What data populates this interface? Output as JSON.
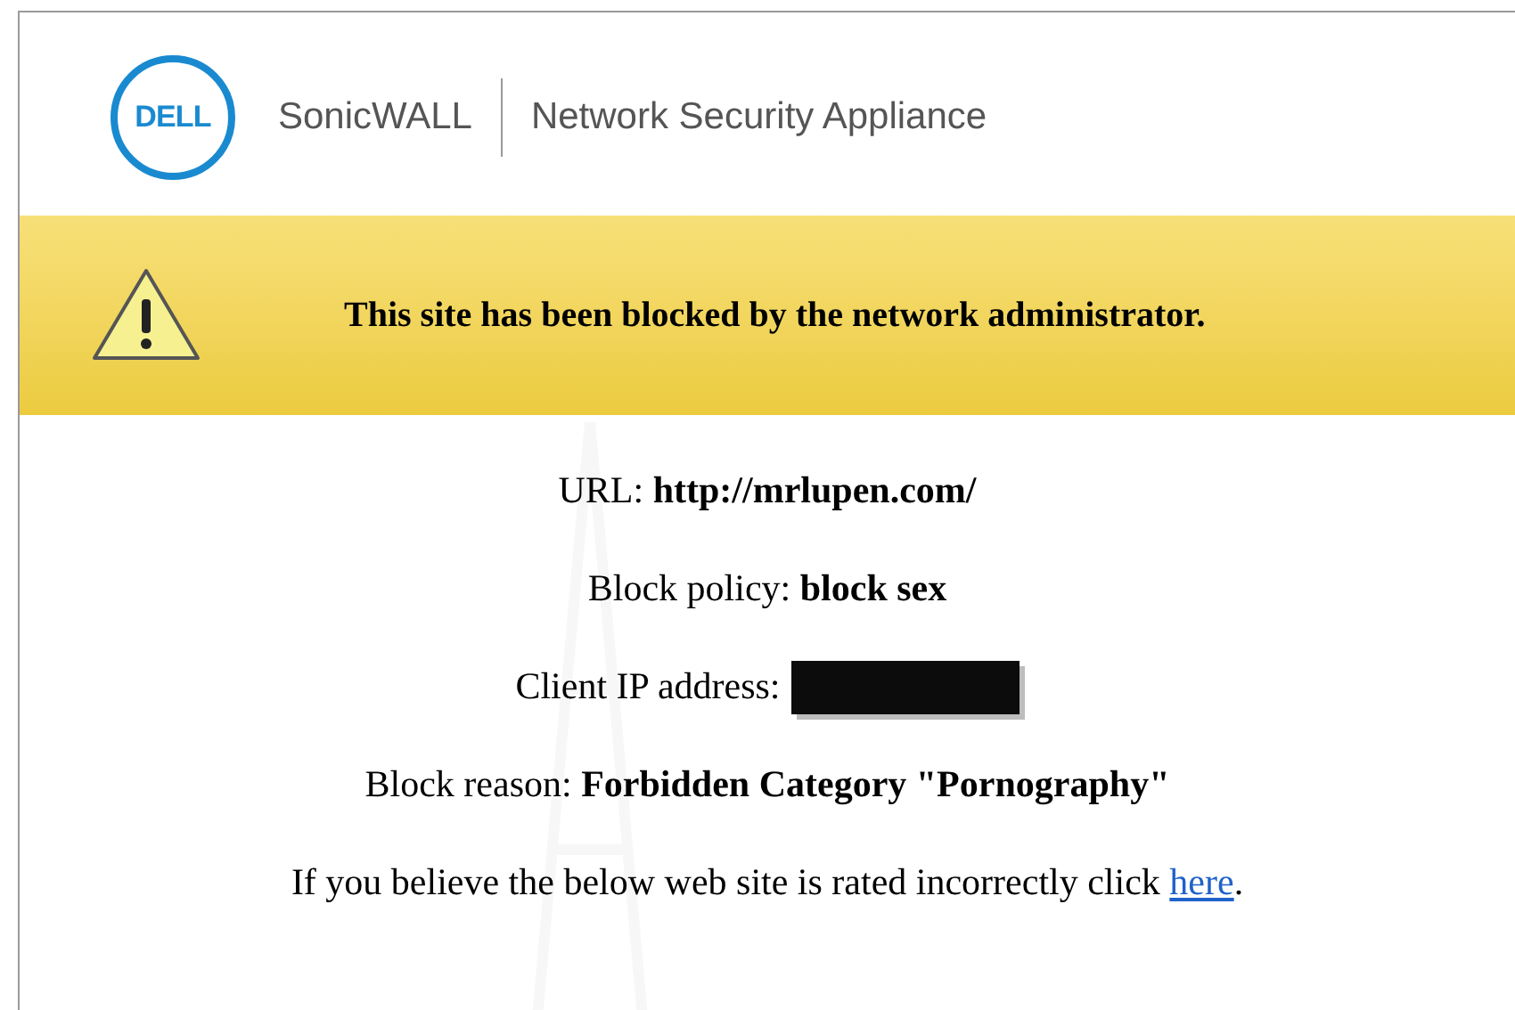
{
  "header": {
    "logo_text": "DELL",
    "brand": "SonicWALL",
    "product": "Network Security Appliance"
  },
  "banner": {
    "message": "This site has been blocked by the network administrator."
  },
  "details": [
    {
      "kind": "text",
      "text": "URL: **http://mrlupen.com/**"
    },
    {
      "kind": "text",
      "text": "Block policy: **block sex**"
    },
    {
      "kind": "redacted",
      "text": "Client IP address:"
    },
    {
      "kind": "text",
      "text": "Block reason: **Forbidden Category \"Pornography\"**"
    }
  ],
  "footer": {
    "text": "If you believe the below web site is rated incorrectly click",
    "link": "here",
    "end": "."
  }
}
